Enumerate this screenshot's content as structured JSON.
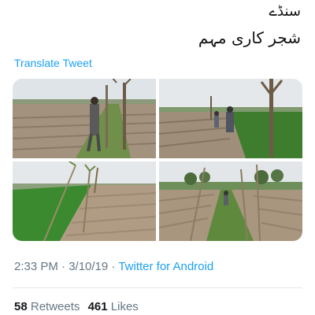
{
  "tweet": {
    "text_line_1": "سنڈے",
    "text_line_2": "شجر کاری مہم",
    "translate_label": "Translate Tweet",
    "timestamp": "2:33 PM · 3/10/19 · ",
    "source": "Twitter for Android",
    "retweet_count": "58",
    "retweet_label": "Retweets",
    "like_count": "461",
    "like_label": "Likes"
  },
  "photos": [
    {
      "subject": "man planting tree in plowed field"
    },
    {
      "subject": "men walking along field path"
    },
    {
      "subject": "row of saplings beside green field"
    },
    {
      "subject": "saplings along dirt track"
    }
  ],
  "colors": {
    "link": "#1da1f2",
    "muted": "#657786",
    "text": "#14171a"
  }
}
